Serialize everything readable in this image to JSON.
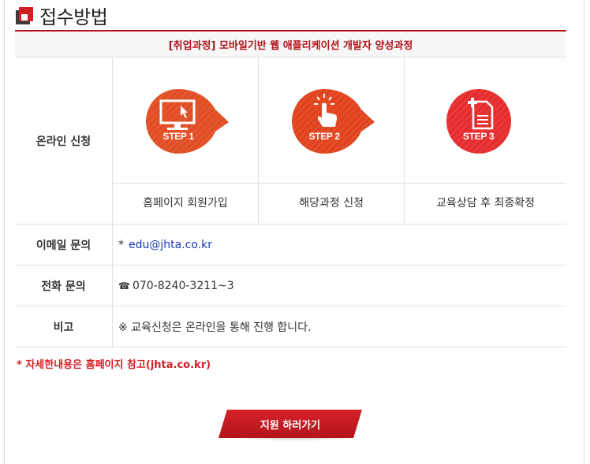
{
  "page": {
    "title": "접수방법",
    "course_title": "[취업과정] 모바일기반 웹 애플리케이션 개발자 양성과정"
  },
  "online": {
    "label": "온라인 신청",
    "steps": [
      {
        "badge": "STEP 1",
        "label": "홈페이지 회원가입",
        "icon": "monitor-cursor-icon",
        "color": "#e04e26"
      },
      {
        "badge": "STEP 2",
        "label": "해당과정 신청",
        "icon": "hand-pointer-icon",
        "color": "#e0431f"
      },
      {
        "badge": "STEP 3",
        "label": "교육상담 후 최종확정",
        "icon": "document-plus-icon",
        "color": "#e52d2f"
      }
    ]
  },
  "rows": [
    {
      "label": "이메일 문의",
      "prefix": "*",
      "value": "edu@jhta.co.kr"
    },
    {
      "label": "전화 문의",
      "prefix": "☎",
      "value": "070-8240-3211~3"
    },
    {
      "label": "비고",
      "prefix": "",
      "value": "※ 교육신청은 온라인을 통해 진행 합니다."
    }
  ],
  "note": "* 자세한내용은 홈페이지 참고(jhta.co.kr)",
  "apply_button": "지원 하러가기"
}
